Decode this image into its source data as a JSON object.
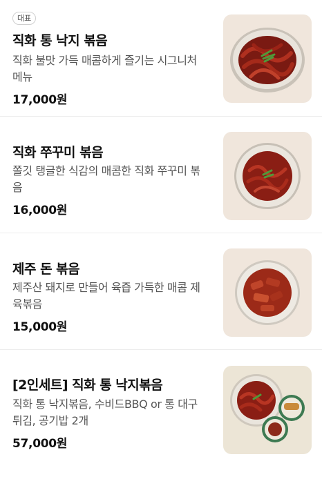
{
  "menu": {
    "items": [
      {
        "badge": "대표",
        "name": "직화 통 낙지 볶음",
        "description": "직화 불맛 가득 매콤하게 즐기는 시그니처 메뉴",
        "price": "17,000원",
        "image_bg": "#f0e6dc",
        "image_icon": "octopus-stir-fry-dish"
      },
      {
        "name": "직화 쭈꾸미 볶음",
        "description": "쫄깃 탱글한 식감의 매콤한 직화 쭈꾸미 볶음",
        "price": "16,000원",
        "image_bg": "#f0e6dc",
        "image_icon": "webfoot-octopus-dish"
      },
      {
        "name": "제주 돈 볶음",
        "description": "제주산 돼지로 만들어 육즙 가득한 매콤 제육볶음",
        "price": "15,000원",
        "image_bg": "#f0e6dc",
        "image_icon": "pork-stir-fry-dish"
      },
      {
        "name": "[2인세트] 직화 통 낙지볶음",
        "description": "직화 통 낙지볶음, 수비드BBQ or 통 대구 튀김, 공기밥 2개",
        "price": "57,000원",
        "image_bg": "#ece5d6",
        "image_icon": "set-meal-dishes"
      }
    ]
  }
}
